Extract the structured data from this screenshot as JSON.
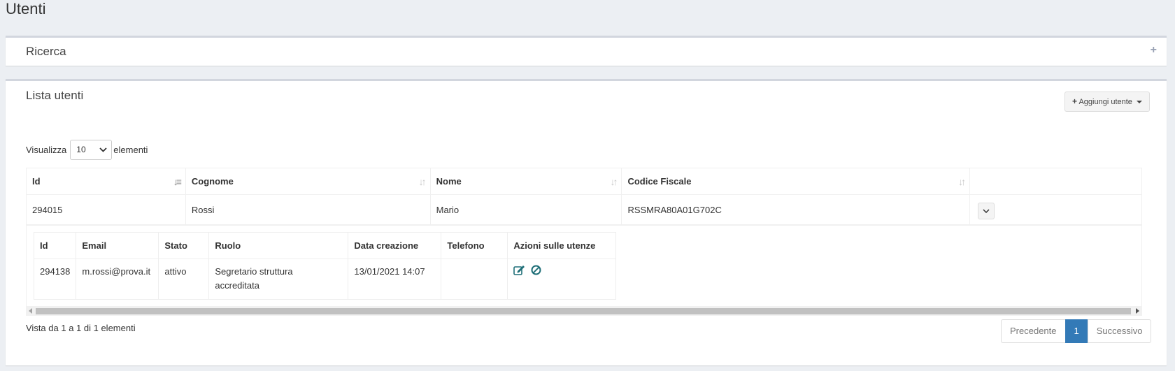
{
  "page": {
    "title": "Utenti"
  },
  "search_box": {
    "title": "Ricerca",
    "toggle_icon": "plus-icon"
  },
  "list_box": {
    "title": "Lista utenti",
    "add_button": {
      "icon": "plus-icon",
      "label": "Aggiungi utente"
    },
    "length": {
      "prefix": "Visualizza",
      "value": "10",
      "suffix": "elementi"
    },
    "table": {
      "columns": [
        "Id",
        "Cognome",
        "Nome",
        "Codice Fiscale"
      ],
      "rows": [
        {
          "id": "294015",
          "cognome": "Rossi",
          "nome": "Mario",
          "codice_fiscale": "RSSMRA80A01G702C"
        }
      ]
    },
    "detail": {
      "columns": [
        "Id",
        "Email",
        "Stato",
        "Ruolo",
        "Data creazione",
        "Telefono",
        "Azioni sulle utenze"
      ],
      "rows": [
        {
          "id": "294138",
          "email": "m.rossi@prova.it",
          "stato": "attivo",
          "ruolo_line1": "Segretario struttura",
          "ruolo_line2": "accreditata",
          "data_creazione": "13/01/2021 14:07",
          "telefono": "",
          "actions": [
            "edit-icon",
            "ban-icon"
          ]
        }
      ]
    },
    "info": "Vista da 1 a 1 di 1 elementi",
    "pagination": {
      "prev": "Precedente",
      "current": "1",
      "next": "Successivo"
    }
  },
  "colors": {
    "accent": "#337ab7",
    "icon_teal": "#1f6f78"
  }
}
